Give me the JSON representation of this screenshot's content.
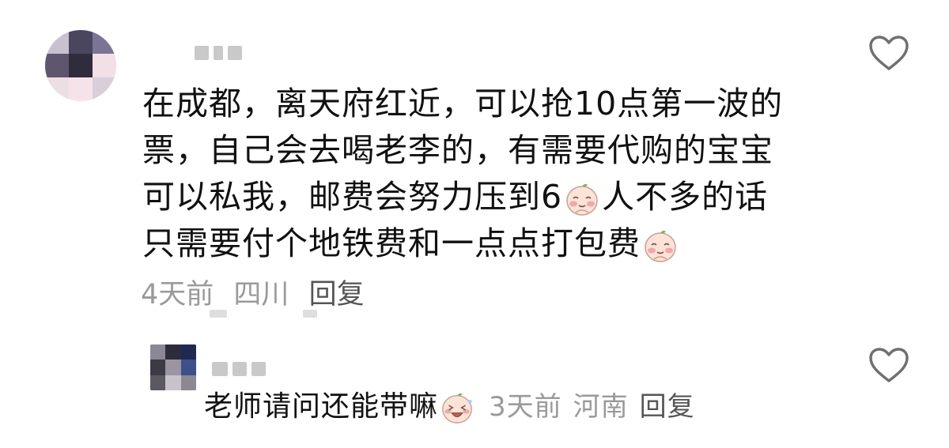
{
  "comments": [
    {
      "text_line1": "在成都，离天府红近，可以抢10点第一波的",
      "text_line2": "票，自己会去喝老李的，有需要代购的宝宝",
      "text_line3a": "可以私我，邮费会努力压到6",
      "text_line3b": "人不多的话",
      "text_line4": "只需要付个地铁费和一点点打包费",
      "time": "4天前",
      "location": "四川",
      "reply_label": "回复",
      "emoji": "blushing-peach-emoji"
    },
    {
      "text": "老师请问还能带嘛",
      "time": "3天前",
      "location": "河南",
      "reply_label": "回复",
      "emoji": "laughing-peach-emoji"
    }
  ],
  "icons": {
    "like": "heart-outline-icon"
  },
  "colors": {
    "text": "#111111",
    "meta": "#9a9a9a",
    "reply": "#555555",
    "heart_stroke": "#707070"
  }
}
